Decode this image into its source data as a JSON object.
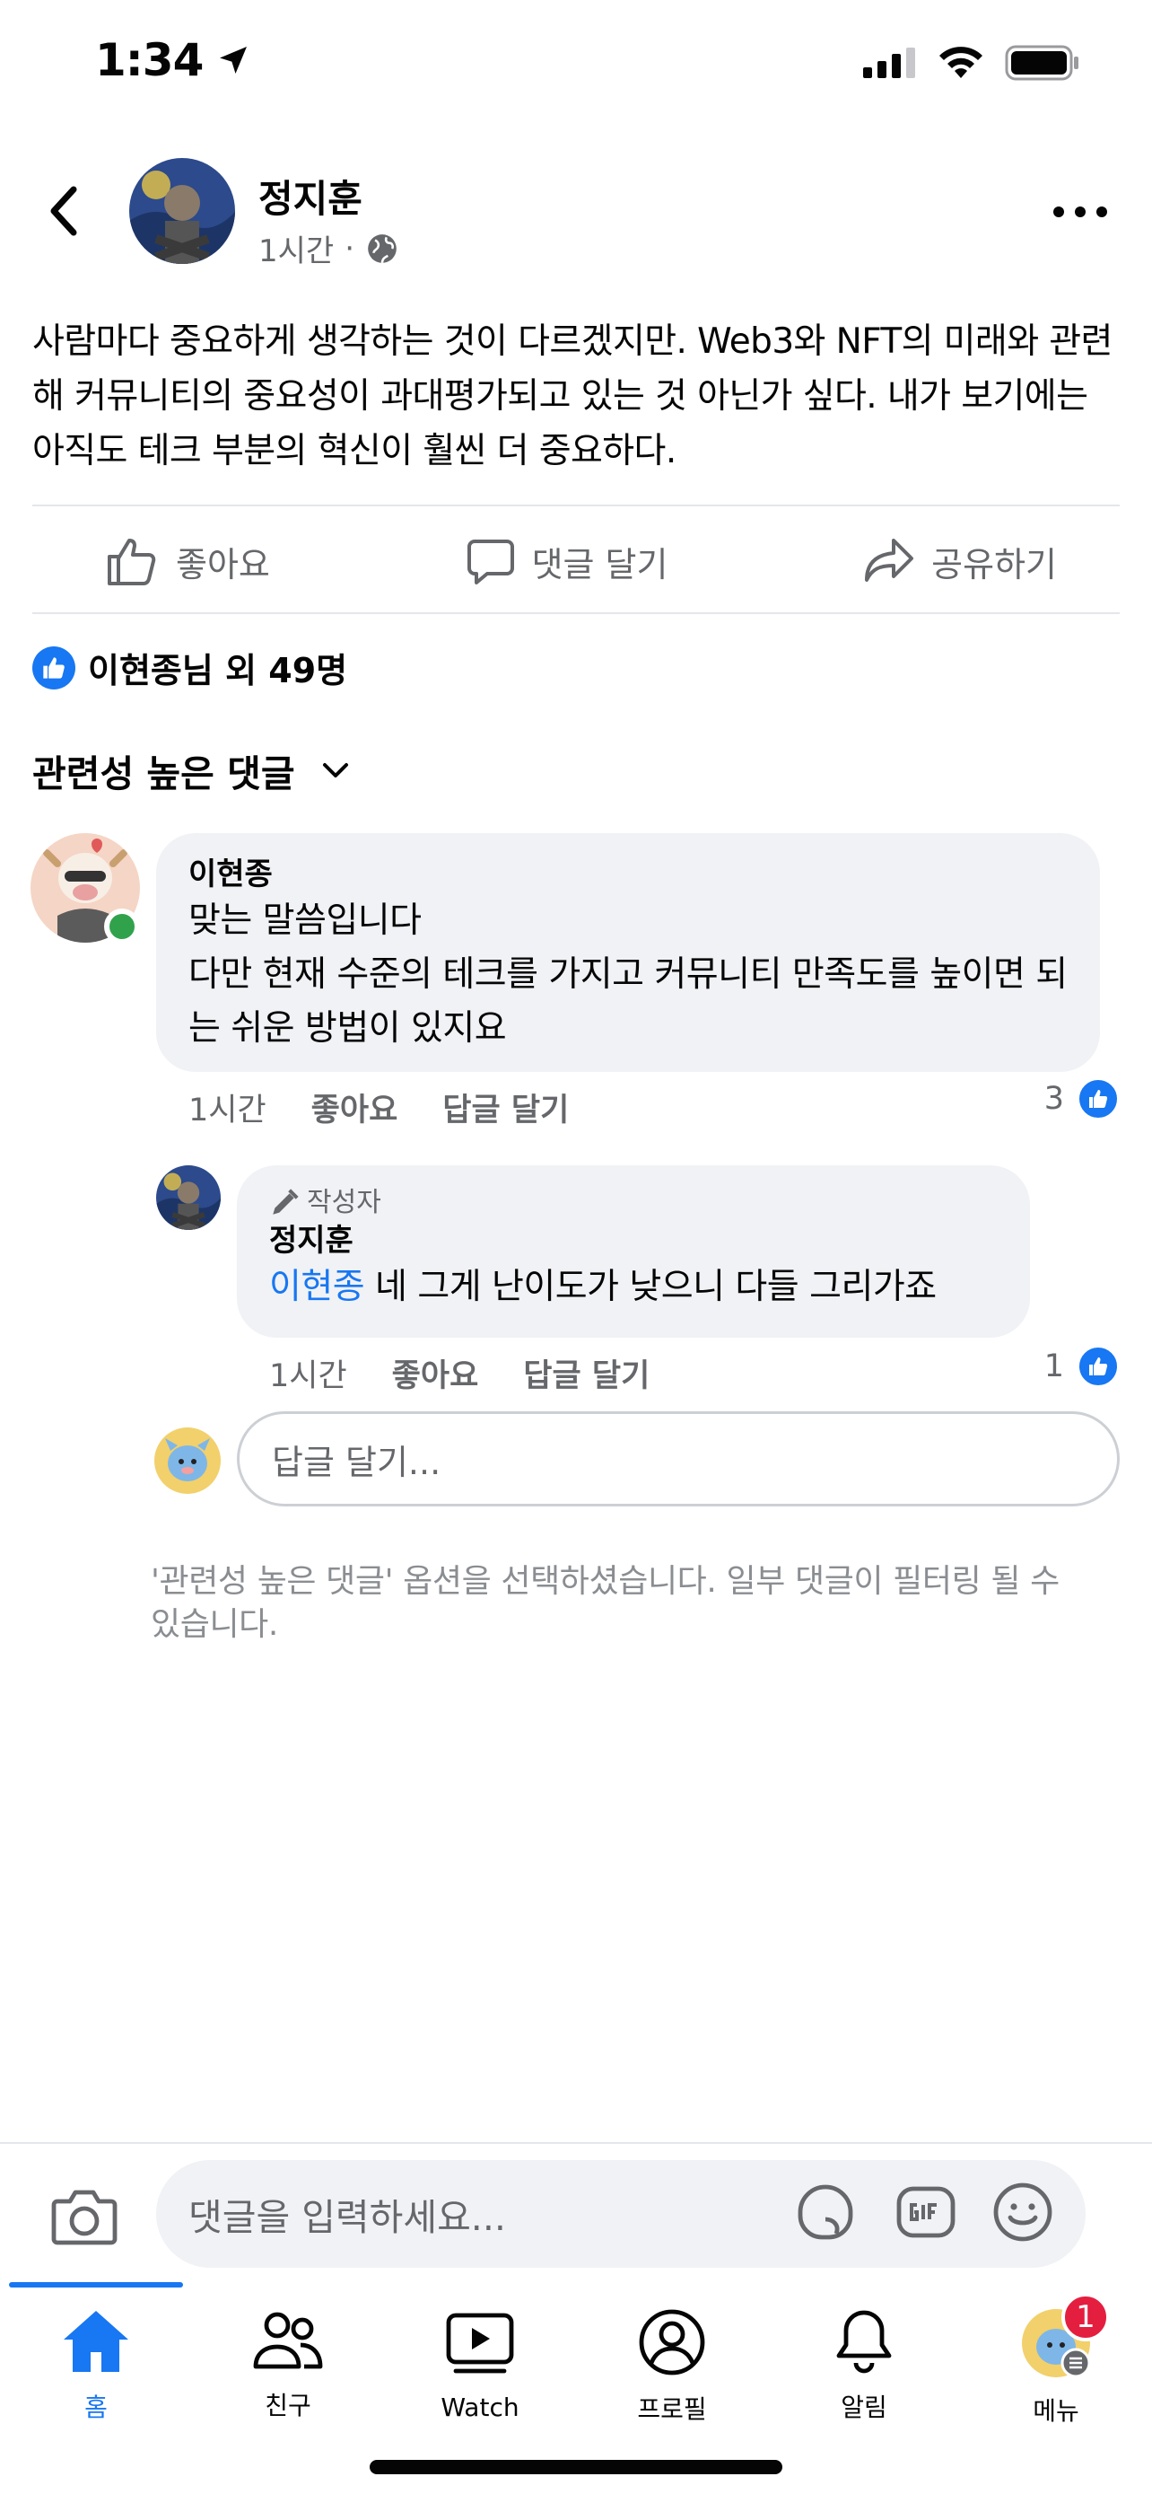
{
  "status_bar": {
    "time": "1:34"
  },
  "post": {
    "author": "정지훈",
    "time": "1시간",
    "separator": "·",
    "text": "사람마다 중요하게 생각하는 것이 다르겠지만. Web3와 NFT의 미래와 관련해 커뮤니티의 중요성이 과대평가되고 있는 것 아닌가 싶다. 내가 보기에는 아직도 테크 부분의 혁신이 훨씬 더 중요하다.",
    "actions": {
      "like": "좋아요",
      "comment": "댓글 달기",
      "share": "공유하기"
    },
    "reactions_text": "이현종님 외 49명"
  },
  "comments_sort": {
    "label": "관련성 높은 댓글"
  },
  "comments": [
    {
      "author": "이현종",
      "text": "맞는 말씀입니다\n다만 현재 수준의 테크를 가지고 커뮤니티 만족도를 높이면 되는 쉬운 방법이 있지요",
      "time": "1시간",
      "like_label": "좋아요",
      "reply_label": "답글 달기",
      "like_count": "3"
    }
  ],
  "reply": {
    "badge": "작성자",
    "author": "정지훈",
    "mention": "이현종",
    "text": " 네 그게 난이도가 낮으니 다들 그리가죠",
    "time": "1시간",
    "like_label": "좋아요",
    "reply_label": "답글 달기",
    "like_count": "1"
  },
  "reply_input": {
    "placeholder": "답글 달기..."
  },
  "filter_note": "'관련성 높은 댓글' 옵션을 선택하셨습니다. 일부 댓글이 필터링 될 수 있습니다.",
  "comment_bar": {
    "placeholder": "댓글을 입력하세요..."
  },
  "tabs": [
    {
      "label": "홈",
      "icon": "home-icon"
    },
    {
      "label": "친구",
      "icon": "friends-icon"
    },
    {
      "label": "Watch",
      "icon": "watch-icon"
    },
    {
      "label": "프로필",
      "icon": "profile-icon"
    },
    {
      "label": "알림",
      "icon": "bell-icon"
    },
    {
      "label": "메뉴",
      "icon": "menu-icon",
      "badge": "1"
    }
  ],
  "colors": {
    "accent": "#1877f2",
    "online": "#31a24c",
    "badge": "#e41e3f"
  }
}
